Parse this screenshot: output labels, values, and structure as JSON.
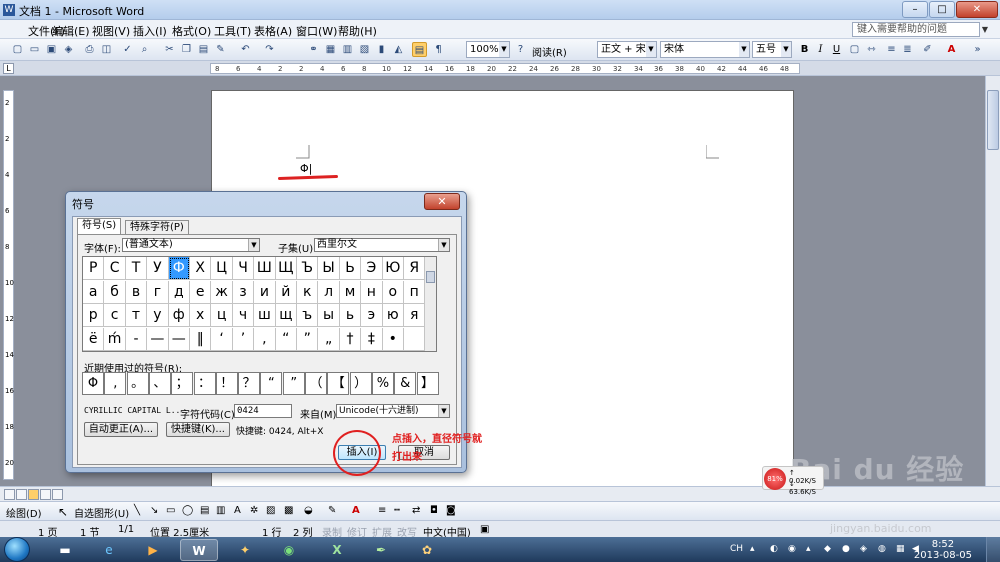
{
  "window": {
    "title": "文档 1 - Microsoft Word",
    "min": "–",
    "max": "□",
    "close": "✕"
  },
  "menu": {
    "items": [
      "文件(F)",
      "编辑(E)",
      "视图(V)",
      "插入(I)",
      "格式(O)",
      "工具(T)",
      "表格(A)",
      "窗口(W)",
      "帮助(H)"
    ],
    "help_placeholder": "键入需要帮助的问题"
  },
  "toolbar": {
    "zoom": "100%",
    "read_label": "阅读(R)",
    "style": "正文 + 宋体",
    "font": "宋体",
    "size": "五号",
    "bold": "B",
    "italic": "I",
    "underline": "U",
    "font_color_letter": "A"
  },
  "ruler": {
    "ticks": [
      "8",
      "6",
      "4",
      "2",
      "2",
      "4",
      "6",
      "8",
      "10",
      "12",
      "14",
      "16",
      "18",
      "20",
      "22",
      "24",
      "26",
      "28",
      "30",
      "32",
      "34",
      "36",
      "38",
      "40",
      "42",
      "44",
      "46",
      "48"
    ],
    "vticks": [
      "2",
      "2",
      "4",
      "6",
      "8",
      "10",
      "12",
      "14",
      "16",
      "18",
      "20"
    ]
  },
  "document": {
    "text": "Φ|"
  },
  "dialog": {
    "title": "符号",
    "close": "✕",
    "tabs": [
      "符号(S)",
      "特殊字符(P)"
    ],
    "font_label": "字体(F):",
    "font_value": "(普通文本)",
    "subset_label": "子集(U):",
    "subset_value": "西里尔文",
    "grid": [
      [
        "Р",
        "С",
        "Т",
        "У",
        "Ф",
        "Х",
        "Ц",
        "Ч",
        "Ш",
        "Щ",
        "Ъ",
        "Ы",
        "Ь",
        "Э",
        "Ю",
        "Я"
      ],
      [
        "а",
        "б",
        "в",
        "г",
        "д",
        "е",
        "ж",
        "з",
        "и",
        "й",
        "к",
        "л",
        "м",
        "н",
        "о",
        "п"
      ],
      [
        "р",
        "с",
        "т",
        "у",
        "ф",
        "х",
        "ц",
        "ч",
        "ш",
        "щ",
        "ъ",
        "ы",
        "ь",
        "э",
        "ю",
        "я"
      ],
      [
        "ё",
        "ḿ",
        "-",
        "—",
        "—",
        "‖",
        "‘",
        "’",
        ",",
        "“",
        "”",
        "„",
        "†",
        "‡",
        "•",
        ""
      ]
    ],
    "recent_label": "近期使用过的符号(R):",
    "recent": [
      "Φ",
      ",",
      "。",
      "、",
      "；",
      "：",
      "！",
      "？",
      "“",
      "”",
      "（",
      "【",
      "）",
      "%",
      "&",
      "】"
    ],
    "char_name": "CYRILLIC CAPITAL L...",
    "char_code_label": "字符代码(C):",
    "char_code": "0424",
    "from_label": "来自(M):",
    "from_value": "Unicode(十六进制)",
    "autocorrect_btn": "自动更正(A)...",
    "shortcut_btn": "快捷键(K)...",
    "shortcut_text": "快捷键: 0424, Alt+X",
    "insert_btn": "插入(I)",
    "cancel_btn": "取消"
  },
  "annotation": {
    "line1": "点插入，直径符号就",
    "line2": "打出来"
  },
  "drawbar": {
    "draw": "绘图(D)",
    "autoshape": "自选图形(U)"
  },
  "status": {
    "page": "1 页",
    "section": "1 节",
    "pages": "1/1",
    "position": "位置 2.5厘米",
    "line": "1 行",
    "col": "2 列",
    "rec": "录制",
    "trk": "修订",
    "ext": "扩展",
    "ovr": "改写",
    "lang": "中文(中国)"
  },
  "netwidget": {
    "pct": "81%",
    "up": "0.02K/S",
    "down": "63.6K/S"
  },
  "watermark": {
    "logo": "Bai du 经验",
    "url": "jingyan.baidu.com"
  },
  "taskbar": {
    "ime": "CH",
    "time": "8:52",
    "date": "2013-08-05"
  },
  "colors": {
    "accent": "#3399ff",
    "annotation": "#e02020"
  }
}
